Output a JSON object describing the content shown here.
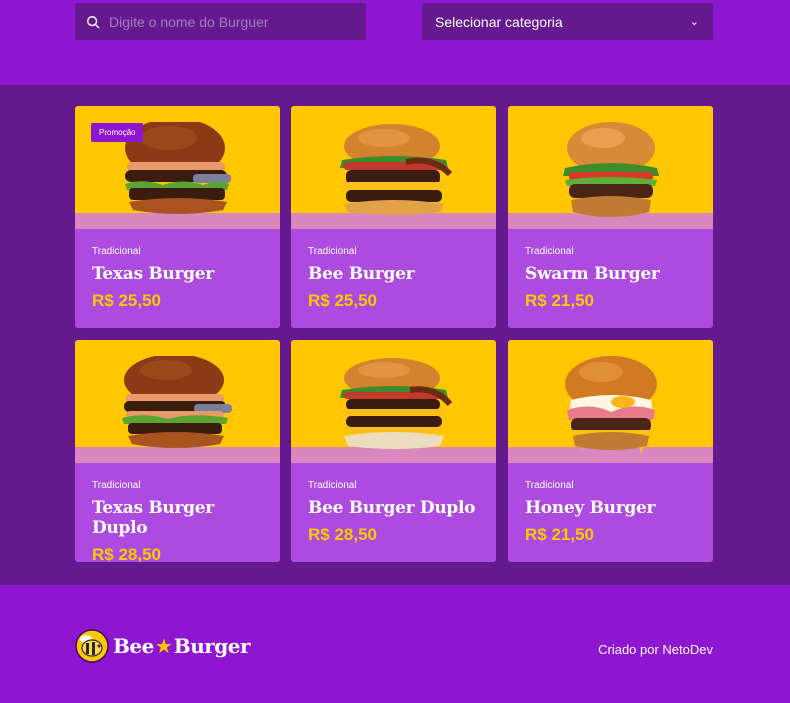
{
  "filters": {
    "search_placeholder": "Digite o nome do Burguer",
    "category_select_label": "Selecionar categoria"
  },
  "products": [
    {
      "category": "Tradicional",
      "name": "Texas Burger",
      "price": "R$ 25,50",
      "badge": "Promoção"
    },
    {
      "category": "Tradicional",
      "name": "Bee Burger",
      "price": "R$ 25,50"
    },
    {
      "category": "Tradicional",
      "name": "Swarm Burger",
      "price": "R$ 21,50"
    },
    {
      "category": "Tradicional",
      "name": "Texas Burger Duplo",
      "price": "R$ 28,50"
    },
    {
      "category": "Tradicional",
      "name": "Bee Burger Duplo",
      "price": "R$ 28,50"
    },
    {
      "category": "Tradicional",
      "name": "Honey Burger",
      "price": "R$ 21,50"
    }
  ],
  "footer": {
    "logo_left": "Bee",
    "logo_star": "★",
    "logo_right": "Burger",
    "credit": "Criado por NetoDev"
  },
  "colors": {
    "brand_purple": "#8e16d0",
    "dark_purple": "#65198e",
    "card_purple": "#ad4be0",
    "yellow": "#ffc700",
    "pink_floor": "#d987be"
  },
  "icons": {
    "search": "search-icon",
    "chevron": "chevron-down-icon",
    "bee": "bee-logo-icon"
  }
}
